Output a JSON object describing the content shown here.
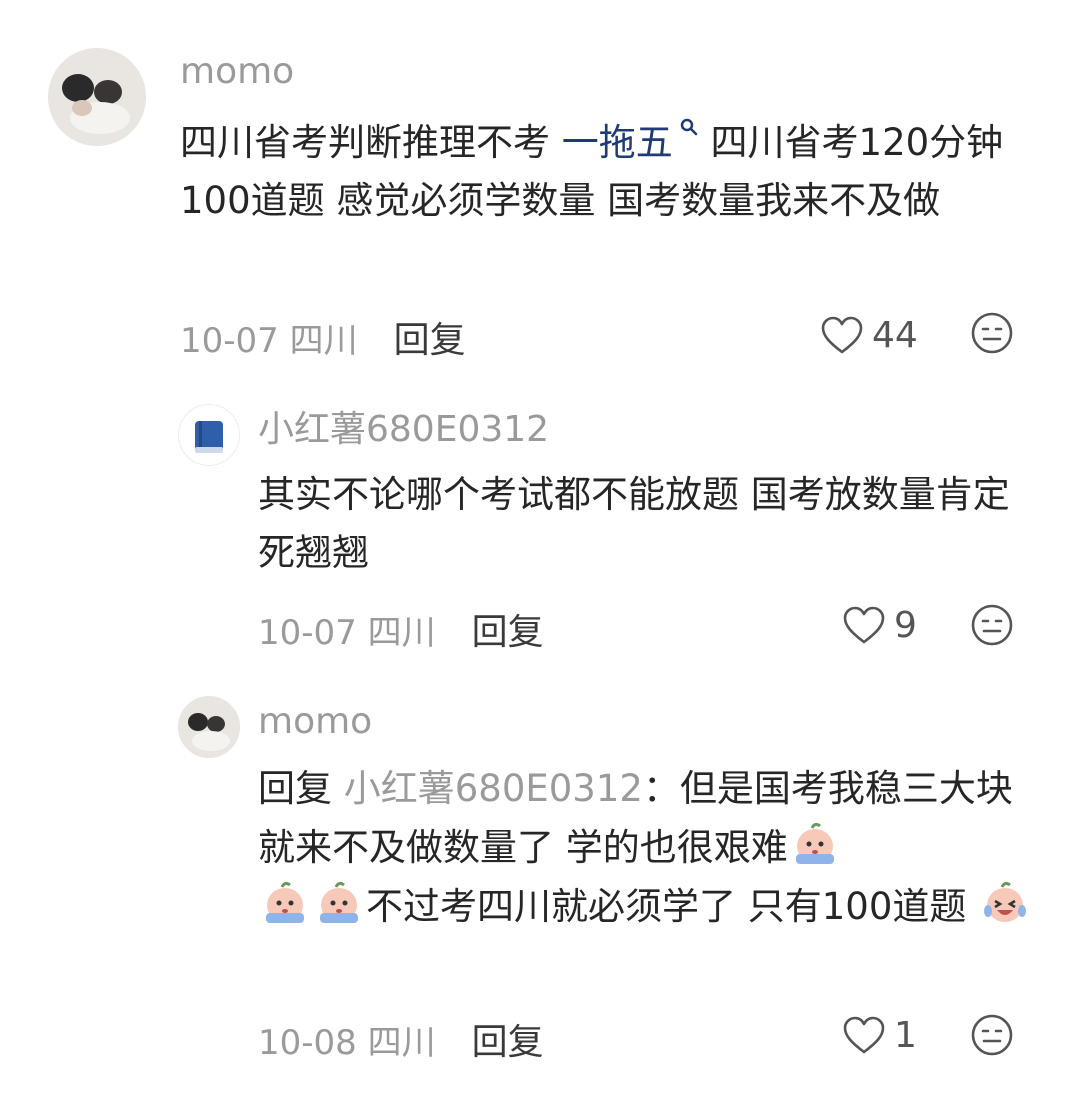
{
  "comments": [
    {
      "user": "momo",
      "text_a": "四川省考判断推理不考 ",
      "keyword": "一拖五",
      "text_b": " 四川省考120分钟100道题 感觉必须学数量 国考数量我来不及做",
      "date": "10-07 四川",
      "reply_label": "回复",
      "likes": "44"
    },
    {
      "user": "小红薯680E0312",
      "text": "其实不论哪个考试都不能放题 国考放数量肯定死翘翘",
      "date": "10-07 四川",
      "reply_label": "回复",
      "likes": "9"
    },
    {
      "user": "momo",
      "reply_prefix": "回复 ",
      "reply_to": "小红薯680E0312",
      "text_a": "：但是国考我稳三大块就来不及做数量了 学的也很艰难",
      "text_b": "不过考四川就必须学了 只有100道题 ",
      "date": "10-08 四川",
      "reply_label": "回复",
      "likes": "1"
    }
  ],
  "icons": {
    "like": "heart-outline-icon",
    "emoji_face": "neutral-face-icon",
    "keyword_search": "search-icon",
    "crying_emoji": "crying-emoji",
    "laughing_emoji": "laughing-crying-emoji",
    "book_avatar": "blue-book-icon"
  }
}
